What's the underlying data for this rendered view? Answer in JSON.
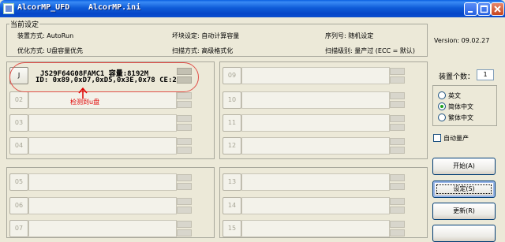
{
  "window": {
    "title_left": "AlcorMP_UFD",
    "title_right": "AlcorMP.ini"
  },
  "settings": {
    "group_label": "当前设定",
    "install_mode": "装置方式: AutoRun",
    "bad_block": "坏块设定: 自动计算容量",
    "serial": "序列号: 随机设定",
    "optimize": "优化方式: U盘容量优先",
    "scan_mode": "扫描方式: 高级格式化",
    "scan_level": "扫描级别: 量产过 (ECC = 默认)"
  },
  "version": "Version: 09.02.27",
  "slots": [
    {
      "label": "J",
      "active": true,
      "line1": "JS29F64G08FAMC1 容量:8192M",
      "line2": "ID: 0x89,0xD7,0xD5,0x3E,0x78  CE:2"
    },
    {
      "label": "02",
      "active": false
    },
    {
      "label": "03",
      "active": false
    },
    {
      "label": "04",
      "active": false
    },
    {
      "label": "05",
      "active": false
    },
    {
      "label": "06",
      "active": false
    },
    {
      "label": "07",
      "active": false
    },
    {
      "label": "09",
      "active": false
    },
    {
      "label": "10",
      "active": false
    },
    {
      "label": "11",
      "active": false
    },
    {
      "label": "12",
      "active": false
    },
    {
      "label": "13",
      "active": false
    },
    {
      "label": "14",
      "active": false
    },
    {
      "label": "15",
      "active": false
    }
  ],
  "annotation": "检测到u盘",
  "sidebar": {
    "device_count_label": "装置个数：",
    "device_count": "1",
    "languages": [
      {
        "label": "英文",
        "selected": false
      },
      {
        "label": "简体中文",
        "selected": true
      },
      {
        "label": "繁体中文",
        "selected": false
      }
    ],
    "auto_production": {
      "label": "自动量产",
      "checked": false
    },
    "buttons": {
      "start": "开始(A)",
      "settings": "设定(S)",
      "refresh": "更新(R)"
    }
  },
  "colors": {
    "titlebar": "#0A4FD0",
    "window_bg": "#ECE9D8",
    "annotation": "#E00000",
    "radio_dot": "#21A121"
  }
}
